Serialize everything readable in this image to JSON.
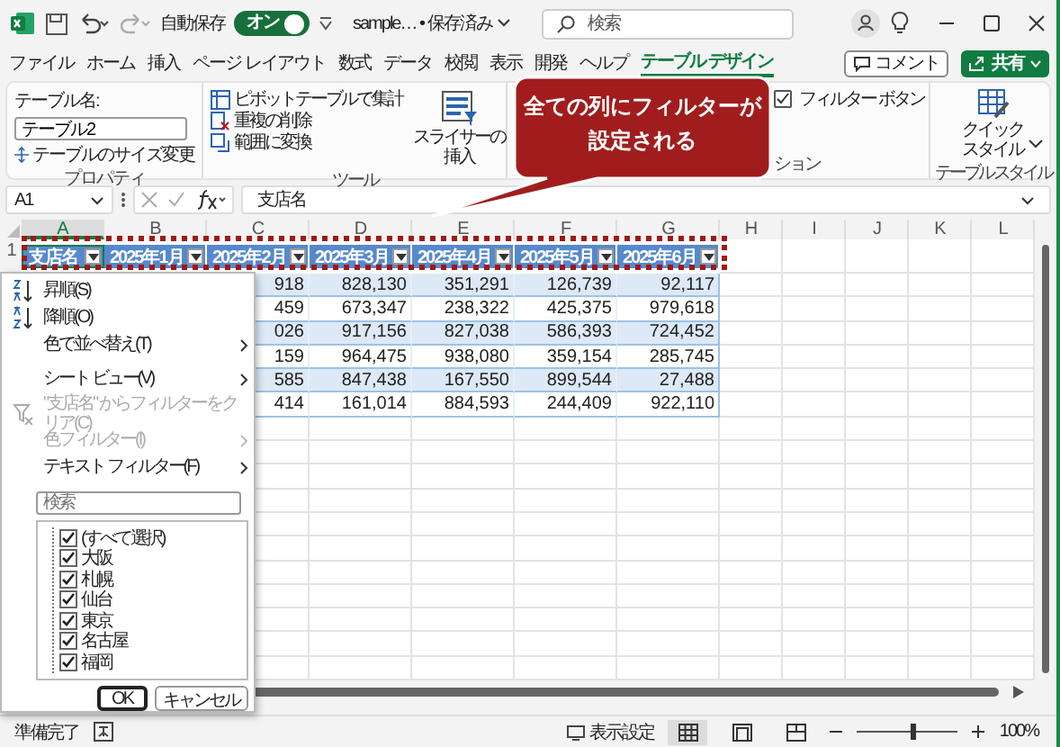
{
  "title_bar": {
    "autosave_label": "自動保存",
    "autosave_toggle": {
      "label": "オン",
      "on": true
    },
    "file_name": "sample…",
    "save_status": "• 保存済み",
    "search": {
      "placeholder": "検索"
    }
  },
  "ribbon_tabs": [
    {
      "label": "ファイル",
      "selected": false
    },
    {
      "label": "ホーム",
      "selected": false
    },
    {
      "label": "挿入",
      "selected": false
    },
    {
      "label": "ページ レイアウト",
      "selected": false
    },
    {
      "label": "数式",
      "selected": false
    },
    {
      "label": "データ",
      "selected": false
    },
    {
      "label": "校閲",
      "selected": false
    },
    {
      "label": "表示",
      "selected": false
    },
    {
      "label": "開発",
      "selected": false
    },
    {
      "label": "ヘルプ",
      "selected": false
    },
    {
      "label": "テーブル デザイン",
      "selected": true
    }
  ],
  "header_buttons": {
    "comment": "コメント",
    "share": "共有"
  },
  "ribbon": {
    "properties": {
      "label": "プロパティ",
      "table_name_label": "テーブル名:",
      "table_name": "テーブル2",
      "resize": "テーブルのサイズ変更"
    },
    "tools": {
      "label": "ツール",
      "commands": [
        "ピボットテーブルで集計",
        "重複の削除",
        "範囲に変換"
      ],
      "slicer_lines": [
        "スライサーの",
        "挿入"
      ]
    },
    "options": {
      "label": "ション",
      "filter_button": {
        "label": "フィルター ボタン",
        "checked": true
      }
    },
    "styles": {
      "label": "テーブル スタイル",
      "quick_style_lines": [
        "クイック",
        "スタイル"
      ]
    }
  },
  "formula_bar": {
    "name_box": "A1",
    "formula": "支店名"
  },
  "sheet": {
    "column_headers": [
      {
        "label": "A",
        "selected": true
      },
      {
        "label": "B",
        "selected": false
      },
      {
        "label": "C",
        "selected": false
      },
      {
        "label": "D",
        "selected": false
      },
      {
        "label": "E",
        "selected": false
      },
      {
        "label": "F",
        "selected": false
      },
      {
        "label": "G",
        "selected": false
      },
      {
        "label": "H",
        "selected": false
      },
      {
        "label": "I",
        "selected": false
      },
      {
        "label": "J",
        "selected": false
      },
      {
        "label": "K",
        "selected": false
      },
      {
        "label": "L",
        "selected": false
      }
    ],
    "row_number": "1",
    "table_headers": [
      "支店名",
      "2025年1月",
      "2025年2月",
      "2025年3月",
      "2025年4月",
      "2025年5月",
      "2025年6月"
    ],
    "rows": [
      [
        "918",
        "828,130",
        "351,291",
        "126,739",
        "92,117"
      ],
      [
        "459",
        "673,347",
        "238,322",
        "425,375",
        "979,618"
      ],
      [
        "026",
        "917,156",
        "827,038",
        "586,393",
        "724,452"
      ],
      [
        "159",
        "964,475",
        "938,080",
        "359,154",
        "285,745"
      ],
      [
        "585",
        "847,438",
        "167,550",
        "899,544",
        "27,488"
      ],
      [
        "414",
        "161,014",
        "884,593",
        "244,409",
        "922,110"
      ]
    ]
  },
  "callout": {
    "lines": [
      "全ての列にフィルターが",
      "設定される"
    ]
  },
  "filter_menu": {
    "items": [
      {
        "kind": "sort-asc",
        "label": "昇順(S)",
        "disabled": false,
        "submenu": false
      },
      {
        "kind": "sort-desc",
        "label": "降順(O)",
        "disabled": false,
        "submenu": false
      },
      {
        "kind": "plain",
        "label": "色で並べ替え(T)",
        "disabled": false,
        "submenu": true
      },
      {
        "kind": "separator"
      },
      {
        "kind": "plain",
        "label": "シート ビュー(V)",
        "disabled": false,
        "submenu": true
      },
      {
        "kind": "separator"
      },
      {
        "kind": "clear-filter",
        "label": "\"支店名\" からフィルターをクリア(C)",
        "disabled": true,
        "submenu": false
      },
      {
        "kind": "plain",
        "label": "色フィルター(I)",
        "disabled": true,
        "submenu": true
      },
      {
        "kind": "plain",
        "label": "テキスト フィルター(F)",
        "disabled": false,
        "submenu": true
      },
      {
        "kind": "separator"
      }
    ],
    "search": {
      "placeholder": "検索"
    },
    "values": [
      {
        "label": "(すべて選択)",
        "checked": true
      },
      {
        "label": "大阪",
        "checked": true
      },
      {
        "label": "札幌",
        "checked": true
      },
      {
        "label": "仙台",
        "checked": true
      },
      {
        "label": "東京",
        "checked": true
      },
      {
        "label": "名古屋",
        "checked": true
      },
      {
        "label": "福岡",
        "checked": true
      }
    ],
    "ok": "OK",
    "cancel": "キャンセル"
  },
  "status_bar": {
    "status": "準備完了",
    "display_settings": "表示設定",
    "views": [
      {
        "kind": "normal",
        "selected": true
      },
      {
        "kind": "page-layout",
        "selected": false
      },
      {
        "kind": "page-break",
        "selected": false
      }
    ],
    "zoom_slider": {
      "level": 0.55
    },
    "zoom": "100%"
  }
}
